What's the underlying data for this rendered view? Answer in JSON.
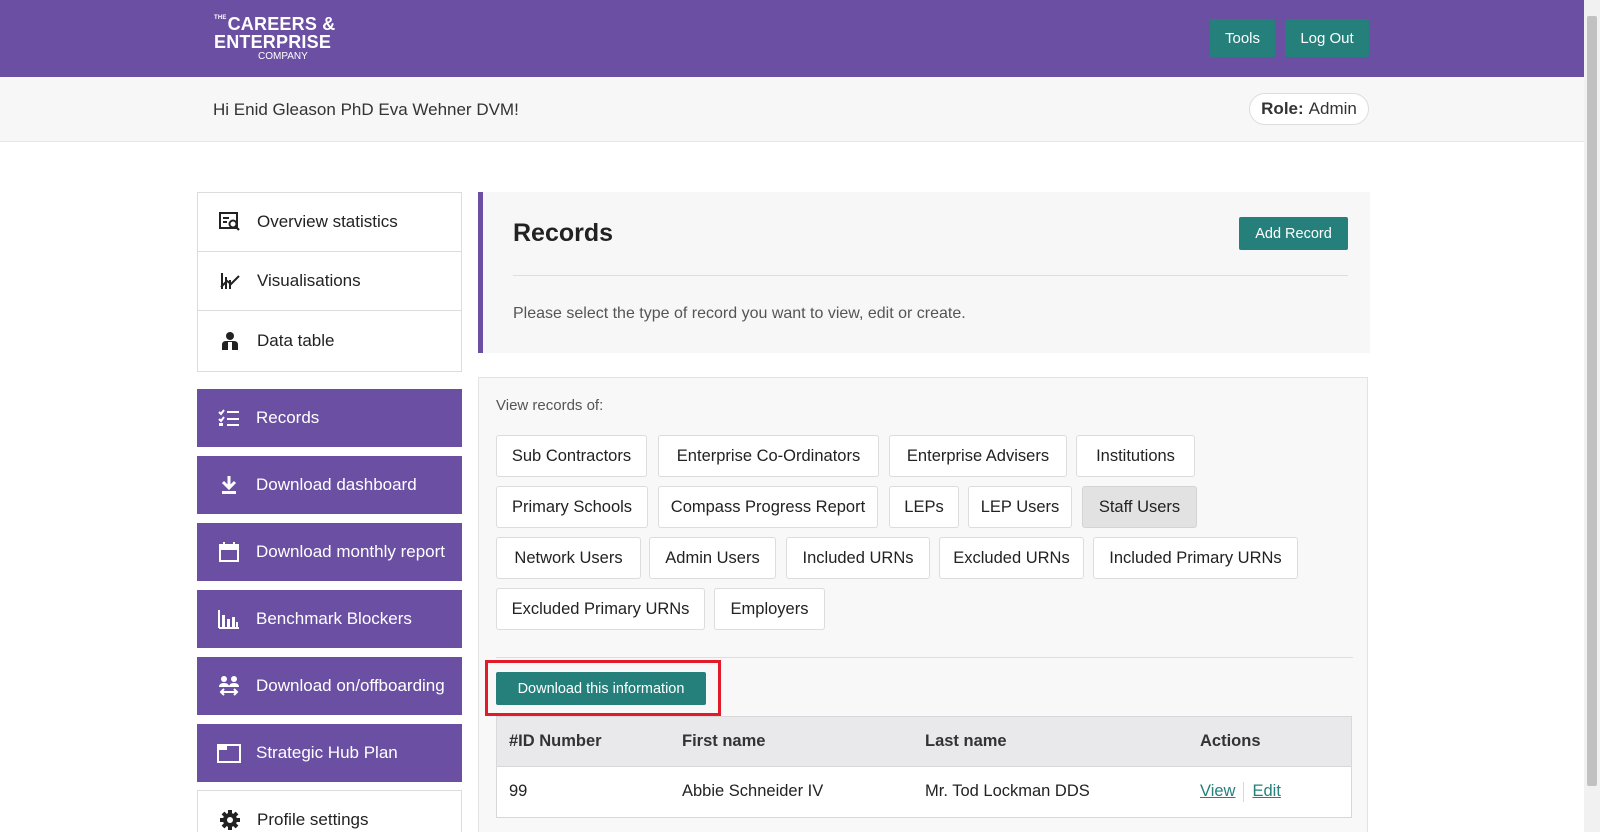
{
  "header": {
    "logo": {
      "line1_prefix": "THE",
      "line1": "CAREERS &",
      "line2": "ENTERPRISE",
      "line3": "COMPANY"
    },
    "tools_label": "Tools",
    "logout_label": "Log Out"
  },
  "greeting": {
    "text": "Hi Enid Gleason PhD Eva Wehner DVM!",
    "role_label": "Role:",
    "role_value": "Admin"
  },
  "sidebar": {
    "items": [
      {
        "label": "Overview statistics",
        "icon": "overview-statistics-icon",
        "style": "white"
      },
      {
        "label": "Visualisations",
        "icon": "visualisations-icon",
        "style": "white"
      },
      {
        "label": "Data table",
        "icon": "data-table-icon",
        "style": "white"
      },
      {
        "label": "Records",
        "icon": "records-list-icon",
        "style": "purple"
      },
      {
        "label": "Download dashboard",
        "icon": "download-icon",
        "style": "purple"
      },
      {
        "label": "Download monthly report",
        "icon": "calendar-icon",
        "style": "purple"
      },
      {
        "label": "Benchmark Blockers",
        "icon": "bar-chart-icon",
        "style": "purple"
      },
      {
        "label": "Download on/offboarding",
        "icon": "people-transfer-icon",
        "style": "purple"
      },
      {
        "label": "Strategic Hub Plan",
        "icon": "folder-icon",
        "style": "purple"
      },
      {
        "label": "Profile settings",
        "icon": "gear-icon",
        "style": "white"
      }
    ]
  },
  "records": {
    "title": "Records",
    "add_label": "Add Record",
    "description": "Please select the type of record you want to view, edit or create."
  },
  "record_types": {
    "label": "View records of:",
    "selected": "Staff Users",
    "items": [
      "Sub Contractors",
      "Enterprise Co-Ordinators",
      "Enterprise Advisers",
      "Institutions",
      "Primary Schools",
      "Compass Progress Report",
      "LEPs",
      "LEP Users",
      "Staff Users",
      "Network Users",
      "Admin Users",
      "Included URNs",
      "Excluded URNs",
      "Included Primary URNs",
      "Excluded Primary URNs",
      "Employers"
    ]
  },
  "download_label": "Download this information",
  "table": {
    "columns": [
      "#ID Number",
      "First name",
      "Last name",
      "Actions"
    ],
    "rows": [
      {
        "id": "99",
        "first_name": "Abbie Schneider IV",
        "last_name": "Mr. Tod Lockman DDS",
        "view_label": "View",
        "edit_label": "Edit"
      }
    ]
  },
  "colors": {
    "brand_purple": "#6a4fa3",
    "action_teal": "#25807c",
    "highlight_red": "#e21b2b"
  }
}
